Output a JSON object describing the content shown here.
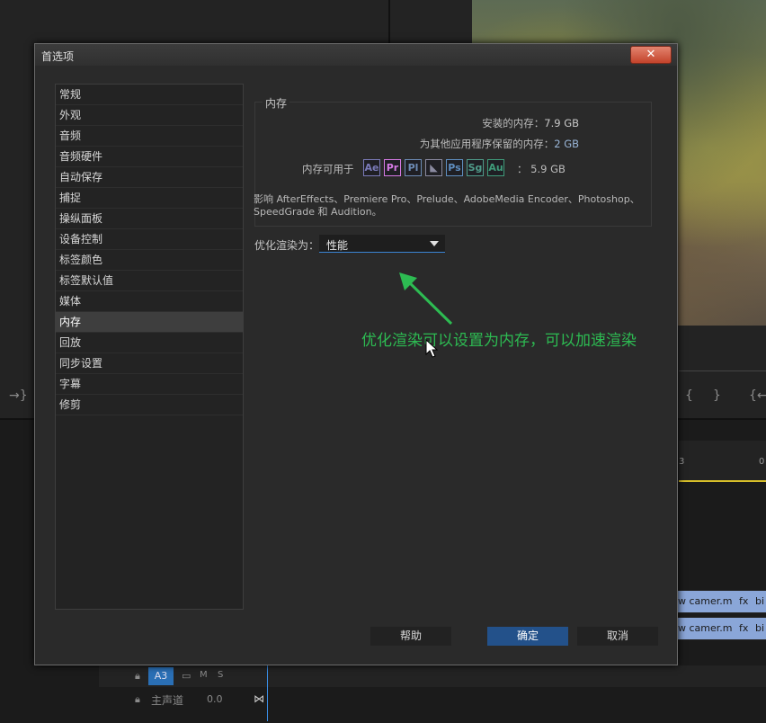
{
  "dialog": {
    "title": "首选项",
    "close_glyph": "✕"
  },
  "categories": [
    "常规",
    "外观",
    "音频",
    "音频硬件",
    "自动保存",
    "捕捉",
    "操纵面板",
    "设备控制",
    "标签颜色",
    "标签默认值",
    "媒体",
    "内存",
    "回放",
    "同步设置",
    "字幕",
    "修剪"
  ],
  "selected_category": "内存",
  "memory": {
    "section_title": "内存",
    "installed_label": "安装的内存：",
    "installed_value": "7.9 GB",
    "reserved_label": "为其他应用程序保留的内存：",
    "reserved_value": "2 GB",
    "available_label": "内存可用于",
    "available_value": "：  5.9 GB",
    "apps": [
      {
        "abbr": "Ae",
        "icon": "after-effects-icon",
        "color": "#7a7ab8"
      },
      {
        "abbr": "Pr",
        "icon": "premiere-pro-icon",
        "color": "#d67ae6"
      },
      {
        "abbr": "Pl",
        "icon": "prelude-icon",
        "color": "#6d8bb5"
      },
      {
        "abbr": "◣",
        "icon": "media-encoder-icon",
        "color": "#8a8aa0"
      },
      {
        "abbr": "Ps",
        "icon": "photoshop-icon",
        "color": "#5f8ec0"
      },
      {
        "abbr": "Sg",
        "icon": "speedgrade-icon",
        "color": "#4f9b8a"
      },
      {
        "abbr": "Au",
        "icon": "audition-icon",
        "color": "#3f9b7a"
      }
    ],
    "affects_text": "影响 AfterEffects、Premiere Pro、Prelude、AdobeMedia Encoder、Photoshop、SpeedGrade 和 Audition。"
  },
  "optimize": {
    "label": "优化渲染为：",
    "value": "性能"
  },
  "annotation": "优化渲染可以设置为内存，可以加速渲染",
  "buttons": {
    "help": "帮助",
    "ok": "确定",
    "cancel": "取消"
  },
  "background": {
    "clip_label": "w camer.m",
    "clip_fx": "fx",
    "clip_tail": "bi",
    "ruler_label": "3",
    "ruler_label_2": "0",
    "track_name": "A3",
    "track_m": "M",
    "track_s": "S",
    "master_label": "主声道",
    "master_value": "0.0",
    "ctrl_left": "→}",
    "ctrl_right_1": "{",
    "ctrl_right_2": "}",
    "ctrl_right_3": "{←"
  },
  "colors": {
    "accent_blue": "#23518a",
    "annotation_green": "#2dbb52",
    "timeline_yellow": "#d8c02a"
  }
}
